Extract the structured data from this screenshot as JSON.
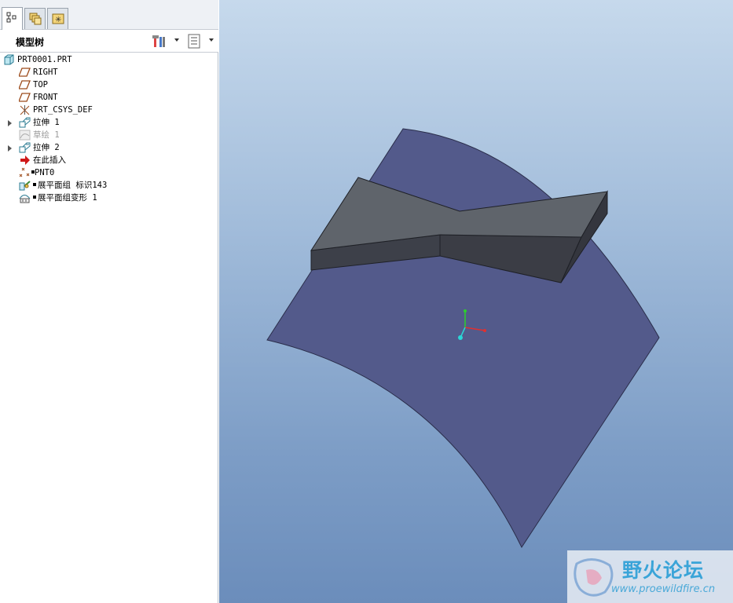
{
  "panel": {
    "title": "模型树",
    "tabs": [
      "model-tree-tab",
      "layer-tree-tab",
      "favorites-tab"
    ]
  },
  "tree": {
    "items": [
      {
        "label": "PRT0001.PRT",
        "icon": "part-icon"
      },
      {
        "label": "RIGHT",
        "icon": "datum-plane-icon"
      },
      {
        "label": "TOP",
        "icon": "datum-plane-icon"
      },
      {
        "label": "FRONT",
        "icon": "datum-plane-icon"
      },
      {
        "label": "PRT_CSYS_DEF",
        "icon": "coordinate-system-icon"
      },
      {
        "label": "拉伸 1",
        "icon": "extrude-icon"
      },
      {
        "label": "草绘 1",
        "icon": "sketch-icon"
      },
      {
        "label": "拉伸 2",
        "icon": "extrude-icon"
      },
      {
        "label": "在此插入",
        "icon": "insert-here-icon"
      },
      {
        "label": "PNT0",
        "icon": "datum-point-icon"
      },
      {
        "label": "展平面组 标识143",
        "icon": "flatten-quilt-icon"
      },
      {
        "label": "展平面组变形 1",
        "icon": "flatten-deform-icon"
      }
    ]
  },
  "colors": {
    "surface": "#535a8b",
    "body_top": "#5f646b",
    "body_side": "#3c3f48",
    "viewport_top": "#c6d9ec",
    "viewport_bottom": "#6b8dbb"
  },
  "watermark": {
    "title": "野火论坛",
    "url": "www.proewildfire.cn"
  }
}
